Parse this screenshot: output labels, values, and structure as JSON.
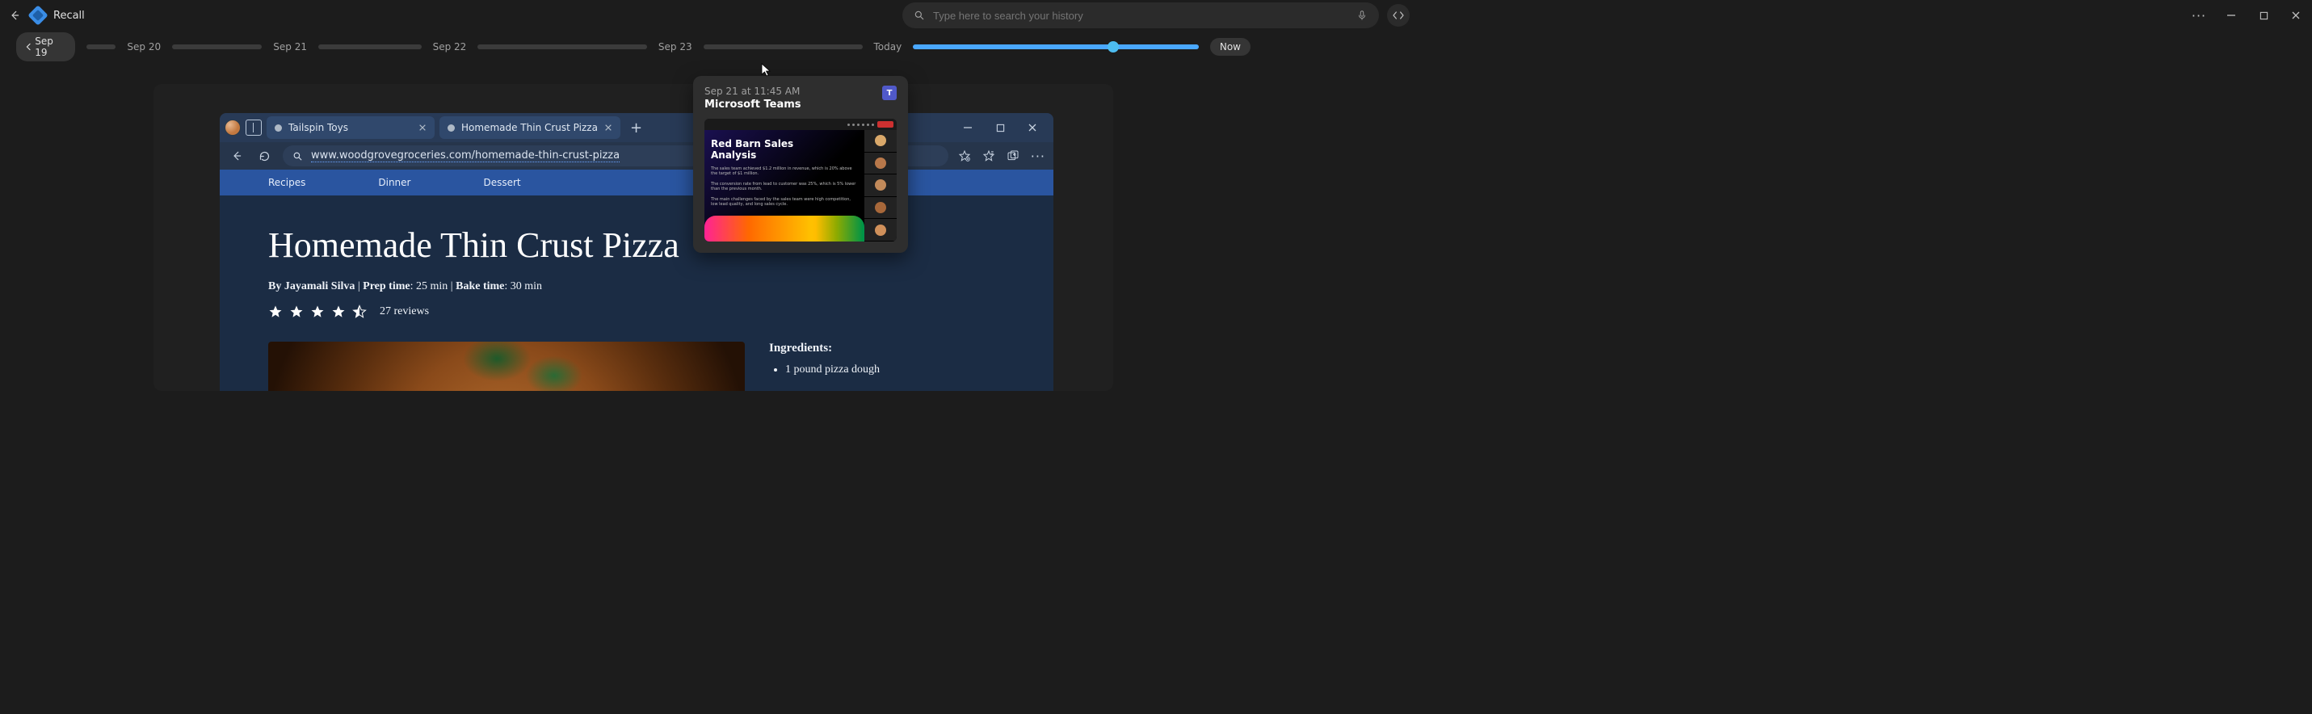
{
  "titlebar": {
    "app_name": "Recall",
    "search_placeholder": "Type here to search your history"
  },
  "timeline": {
    "start_pill": "Sep 19",
    "end_pill": "Now",
    "labels": [
      "Sep 20",
      "Sep 21",
      "Sep 22",
      "Sep 23",
      "Today"
    ]
  },
  "preview": {
    "timestamp": "Sep 21 at 11:45 AM",
    "app": "Microsoft Teams",
    "icon_letter": "T",
    "slide_title_l1": "Red Barn Sales",
    "slide_title_l2": "Analysis",
    "para1": "The sales team achieved $1.2 million in revenue, which is 20% above the target of $1 million.",
    "para2": "The conversion rate from lead to customer was 25%, which is 5% lower than the previous month.",
    "para3": "The main challenges faced by the sales team were high competition, low lead quality, and long sales cycle."
  },
  "browser": {
    "tabs": [
      {
        "label": "Tailspin Toys"
      },
      {
        "label": "Homemade Thin Crust Pizza"
      }
    ],
    "url": "www.woodgrovegroceries.com/homemade-thin-crust-pizza",
    "nav": [
      "Recipes",
      "Dinner",
      "Dessert"
    ],
    "page": {
      "title": "Homemade Thin Crust Pizza",
      "by_label": "By ",
      "author": "Jayamali Silva",
      "sep": "  |  ",
      "prep_label": "Prep time",
      "prep_value": ": 25 min",
      "bake_label": "Bake time",
      "bake_value": ": 30 min",
      "reviews": "27 reviews",
      "ingredients_heading": "Ingredients:",
      "ingredients": [
        "1 pound pizza dough"
      ]
    }
  }
}
